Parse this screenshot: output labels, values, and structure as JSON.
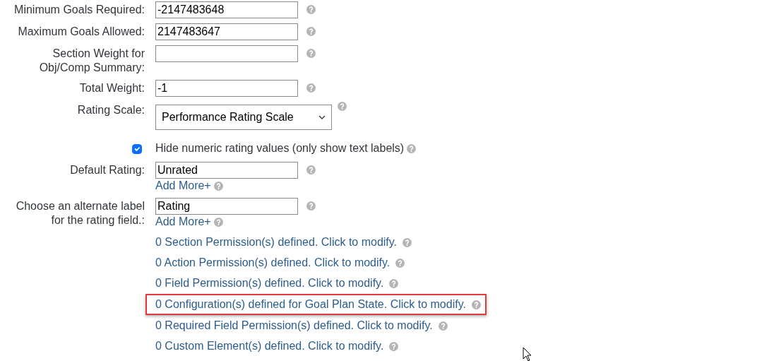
{
  "fields": [
    {
      "kind": "text",
      "label": "Minimum Goals Required:",
      "value": "-2147483648"
    },
    {
      "kind": "text",
      "label": "Maximum Goals Allowed:",
      "value": "2147483647"
    },
    {
      "kind": "text",
      "label": "Section Weight for Obj/Comp Summary:"
    },
    {
      "kind": "text",
      "label": "Total Weight:",
      "value": "-1"
    },
    {
      "kind": "select",
      "label": "Rating Scale:",
      "value": "Performance Rating Scale"
    },
    {
      "kind": "checkbox",
      "text": "Hide numeric rating values (only show text labels)",
      "checked": true
    },
    {
      "kind": "text",
      "label": "Default Rating:",
      "value": "Unrated",
      "add_more": "Add More+"
    },
    {
      "kind": "text",
      "label": "Choose an alternate label for the rating field.:",
      "value": "Rating",
      "add_more": "Add More+"
    }
  ],
  "links": [
    {
      "text": "0 Section Permission(s) defined. Click to modify.",
      "highlighted": false
    },
    {
      "text": "0 Action Permission(s) defined. Click to modify.",
      "highlighted": false
    },
    {
      "text": "0 Field Permission(s) defined. Click to modify.",
      "highlighted": false
    },
    {
      "text": "0 Configuration(s) defined for Goal Plan State. Click to modify.",
      "highlighted": true
    },
    {
      "text": "0 Required Field Permission(s) defined. Click to modify.",
      "highlighted": false
    },
    {
      "text": "0 Custom Element(s) defined. Click to modify.",
      "highlighted": false
    }
  ]
}
